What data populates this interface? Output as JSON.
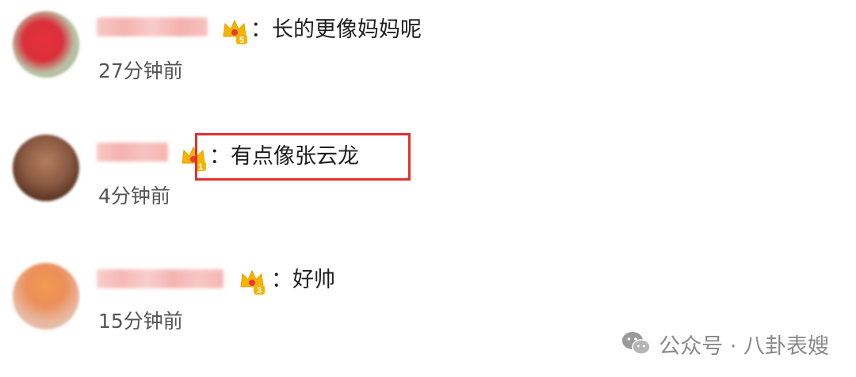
{
  "comments": [
    {
      "badge_level": "5",
      "text": "：长的更像妈妈呢",
      "time": "27分钟前",
      "highlighted": false
    },
    {
      "badge_level": "1",
      "text": "：有点像张云龙",
      "time": "4分钟前",
      "highlighted": true
    },
    {
      "badge_level": "3",
      "text": "：好帅",
      "time": "15分钟前",
      "highlighted": false
    }
  ],
  "watermark": {
    "icon": "wechat-icon",
    "text": "公众号 · 八卦表嫂"
  },
  "colors": {
    "highlight_border": "#e0312f",
    "badge_gold": "#f5b400",
    "badge_red": "#e33b3b",
    "username_blur": "#f6b6b3",
    "timestamp": "#555555",
    "watermark": "#8a8a8a"
  }
}
